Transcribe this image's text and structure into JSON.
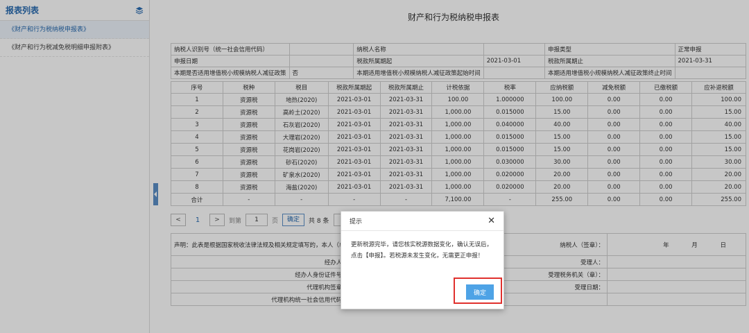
{
  "sidebar": {
    "title": "报表列表",
    "items": [
      {
        "label": "《财产和行为税纳税申报表》"
      },
      {
        "label": "《财产和行为税减免税明细申报附表》"
      }
    ]
  },
  "form": {
    "title": "财产和行为税纳税申报表",
    "info": {
      "taxpayer_id_label": "纳税人识别号（统一社会信用代码）",
      "taxpayer_id_value": "",
      "taxpayer_name_label": "纳税人名称",
      "taxpayer_name_value": "",
      "declare_type_label": "申报类型",
      "declare_type_value": "正常申报",
      "declare_date_label": "申报日期",
      "declare_date_value": "",
      "period_start_label": "税款所属期起",
      "period_start_value": "2021-03-01",
      "period_end_label": "税款所属期止",
      "period_end_value": "2021-03-31",
      "small_scale_label": "本期是否适用增值税小规模纳税人减征政策",
      "small_scale_value": "否",
      "small_scale_start_label": "本期适用增值税小规模纳税人减征政策起始时间",
      "small_scale_start_value": "",
      "small_scale_end_label": "本期适用增值税小规模纳税人减征政策终止时间",
      "small_scale_end_value": ""
    },
    "columns": [
      "序号",
      "税种",
      "税目",
      "税款所属期起",
      "税款所属期止",
      "计税依据",
      "税率",
      "应纳税额",
      "减免税额",
      "已缴税额",
      "应补退税额"
    ],
    "rows": [
      [
        "1",
        "资源税",
        "地热(2020)",
        "2021-03-01",
        "2021-03-31",
        "100.00",
        "1.000000",
        "100.00",
        "0.00",
        "0.00",
        "100.00"
      ],
      [
        "2",
        "资源税",
        "高岭土(2020)",
        "2021-03-01",
        "2021-03-31",
        "1,000.00",
        "0.015000",
        "15.00",
        "0.00",
        "0.00",
        "15.00"
      ],
      [
        "3",
        "资源税",
        "石灰岩(2020)",
        "2021-03-01",
        "2021-03-31",
        "1,000.00",
        "0.040000",
        "40.00",
        "0.00",
        "0.00",
        "40.00"
      ],
      [
        "4",
        "资源税",
        "大理岩(2020)",
        "2021-03-01",
        "2021-03-31",
        "1,000.00",
        "0.015000",
        "15.00",
        "0.00",
        "0.00",
        "15.00"
      ],
      [
        "5",
        "资源税",
        "花岗岩(2020)",
        "2021-03-01",
        "2021-03-31",
        "1,000.00",
        "0.015000",
        "15.00",
        "0.00",
        "0.00",
        "15.00"
      ],
      [
        "6",
        "资源税",
        "砂石(2020)",
        "2021-03-01",
        "2021-03-31",
        "1,000.00",
        "0.030000",
        "30.00",
        "0.00",
        "0.00",
        "30.00"
      ],
      [
        "7",
        "资源税",
        "矿泉水(2020)",
        "2021-03-01",
        "2021-03-31",
        "1,000.00",
        "0.020000",
        "20.00",
        "0.00",
        "0.00",
        "20.00"
      ],
      [
        "8",
        "资源税",
        "海盐(2020)",
        "2021-03-01",
        "2021-03-31",
        "1,000.00",
        "0.020000",
        "20.00",
        "0.00",
        "0.00",
        "20.00"
      ],
      [
        "合计",
        "-",
        "-",
        "-",
        "-",
        "7,100.00",
        "-",
        "255.00",
        "0.00",
        "0.00",
        "255.00"
      ]
    ],
    "pager": {
      "prev": "<",
      "page": "1",
      "next": ">",
      "goto_label": "到第",
      "goto_value": "1",
      "page_label": "页",
      "confirm": "确定",
      "total": "共 8 条",
      "page_size": "2"
    },
    "declaration": {
      "statement": "声明：此表是根据国家税收法律法规及相关规定填写的，本人（单位）",
      "signature_label": "纳税人（签章）：",
      "year": "年",
      "month": "月",
      "day": "日",
      "handler_label": "经办人：",
      "receiver_label": "受理人：",
      "handler_id_label": "经办人身份证件号：",
      "tax_office_label": "受理税务机关（章）：",
      "agency_seal_label": "代理机构签章：",
      "accept_date_label": "受理日期：",
      "agency_code_label": "代理机构统一社会信用代码："
    }
  },
  "dialog": {
    "title": "提示",
    "message": "更新税源完毕，请您核实税源数据变化，确认无误后，点击【申报】。若税源未发生变化，无需更正申报！",
    "ok": "确定"
  }
}
